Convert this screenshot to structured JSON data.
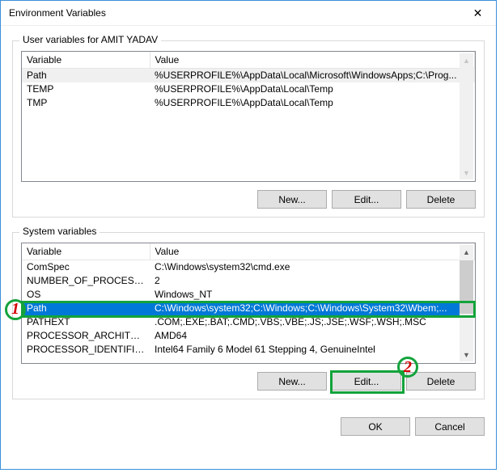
{
  "window": {
    "title": "Environment Variables",
    "close_glyph": "✕"
  },
  "user_section": {
    "legend": "User variables for AMIT YADAV",
    "columns": {
      "c1": "Variable",
      "c2": "Value"
    },
    "rows": [
      {
        "name": "Path",
        "value": "%USERPROFILE%\\AppData\\Local\\Microsoft\\WindowsApps;C:\\Prog..."
      },
      {
        "name": "TEMP",
        "value": "%USERPROFILE%\\AppData\\Local\\Temp"
      },
      {
        "name": "TMP",
        "value": "%USERPROFILE%\\AppData\\Local\\Temp"
      }
    ],
    "selected_index": 0,
    "buttons": {
      "new": "New...",
      "edit": "Edit...",
      "delete": "Delete"
    }
  },
  "system_section": {
    "legend": "System variables",
    "columns": {
      "c1": "Variable",
      "c2": "Value"
    },
    "rows": [
      {
        "name": "ComSpec",
        "value": "C:\\Windows\\system32\\cmd.exe"
      },
      {
        "name": "NUMBER_OF_PROCESSORS",
        "value": "2"
      },
      {
        "name": "OS",
        "value": "Windows_NT"
      },
      {
        "name": "Path",
        "value": "C:\\Windows\\system32;C:\\Windows;C:\\Windows\\System32\\Wbem;..."
      },
      {
        "name": "PATHEXT",
        "value": ".COM;.EXE;.BAT;.CMD;.VBS;.VBE;.JS;.JSE;.WSF;.WSH;.MSC"
      },
      {
        "name": "PROCESSOR_ARCHITECTURE",
        "value": "AMD64"
      },
      {
        "name": "PROCESSOR_IDENTIFIER",
        "value": "Intel64 Family 6 Model 61 Stepping 4, GenuineIntel"
      }
    ],
    "selected_index": 3,
    "buttons": {
      "new": "New...",
      "edit": "Edit...",
      "delete": "Delete"
    }
  },
  "footer": {
    "ok": "OK",
    "cancel": "Cancel"
  },
  "annotations": {
    "badge1": "1",
    "badge2": "2"
  }
}
